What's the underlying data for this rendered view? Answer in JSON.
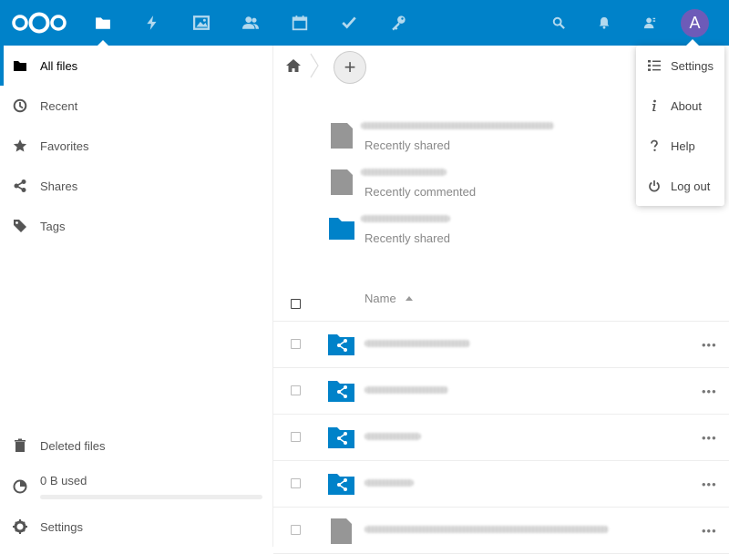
{
  "header": {
    "apps": [
      {
        "name": "files",
        "icon": "folder-icon",
        "active": true
      },
      {
        "name": "activity",
        "icon": "lightning-icon"
      },
      {
        "name": "gallery",
        "icon": "image-icon"
      },
      {
        "name": "contacts",
        "icon": "contacts-icon"
      },
      {
        "name": "calendar",
        "icon": "calendar-icon"
      },
      {
        "name": "tasks",
        "icon": "checkmark-icon"
      },
      {
        "name": "passwords",
        "icon": "key-icon"
      }
    ],
    "avatar_letter": "A",
    "colors": {
      "primary": "#0082c9",
      "avatar": "#6d5bb8"
    }
  },
  "sidebar": {
    "items": [
      {
        "label": "All files",
        "icon": "folder-icon",
        "active": true
      },
      {
        "label": "Recent",
        "icon": "clock-icon"
      },
      {
        "label": "Favorites",
        "icon": "star-icon"
      },
      {
        "label": "Shares",
        "icon": "share-icon"
      },
      {
        "label": "Tags",
        "icon": "tag-icon"
      }
    ],
    "deleted_label": "Deleted files",
    "quota_label": "0 B used",
    "quota_fraction": 0,
    "settings_label": "Settings"
  },
  "breadcrumb": {
    "home_icon": "home-icon",
    "new_button": "+"
  },
  "recommendations": [
    {
      "type": "file",
      "subtitle": "Recently shared"
    },
    {
      "type": "file",
      "subtitle": "Recently commented"
    },
    {
      "type": "folder",
      "subtitle": "Recently shared"
    }
  ],
  "file_list": {
    "name_header": "Name",
    "rows": [
      {
        "type": "shared-folder",
        "menu": "•••"
      },
      {
        "type": "shared-folder",
        "menu": "•••"
      },
      {
        "type": "shared-folder",
        "menu": "•••"
      },
      {
        "type": "shared-folder",
        "menu": "•••"
      },
      {
        "type": "file",
        "menu": "•••"
      }
    ]
  },
  "user_menu": {
    "items": [
      {
        "label": "Settings",
        "icon": "list-settings-icon"
      },
      {
        "label": "About",
        "icon": "info-icon"
      },
      {
        "label": "Help",
        "icon": "help-icon"
      },
      {
        "label": "Log out",
        "icon": "power-icon"
      }
    ]
  }
}
